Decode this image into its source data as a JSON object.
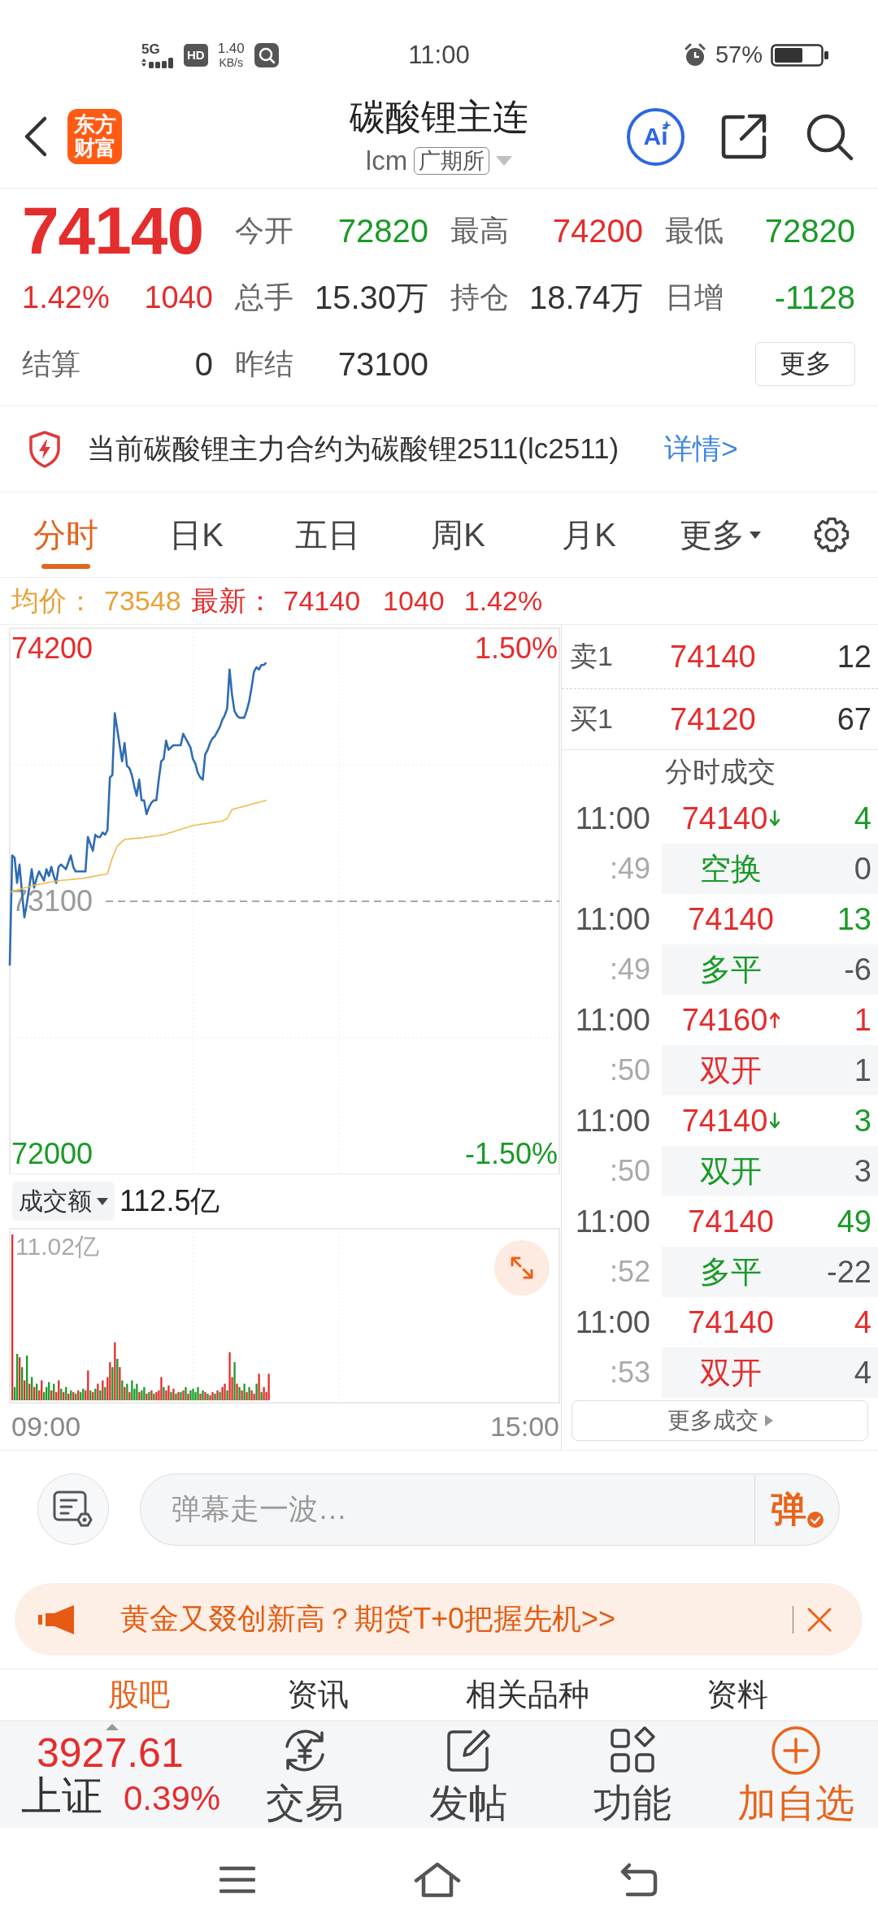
{
  "status_bar": {
    "network": "5G",
    "hd_badge": "HD",
    "speed_value": "1.40",
    "speed_unit": "KB/s",
    "time": "11:00",
    "battery": "57%"
  },
  "header": {
    "logo_text": "东方财富",
    "title": "碳酸锂主连",
    "code": "lcm",
    "exchange": "广期所",
    "ai_label": "Ai"
  },
  "quote": {
    "price": "74140",
    "change_percent": "1.42%",
    "change": "1040",
    "rising": true,
    "stats": [
      {
        "label": "今开",
        "value": "72820",
        "color": "#1a9a28"
      },
      {
        "label": "最高",
        "value": "74200",
        "color": "#e42d2d"
      },
      {
        "label": "最低",
        "value": "72820",
        "color": "#1a9a28"
      },
      {
        "label": "总手",
        "value": "15.30万",
        "color": "#333333"
      },
      {
        "label": "持仓",
        "value": "18.74万",
        "color": "#333333"
      },
      {
        "label": "日增",
        "value": "-1128",
        "color": "#1a9a28"
      },
      {
        "label": "结算",
        "value": "0",
        "color": "#333333"
      },
      {
        "label": "昨结",
        "value": "73100",
        "color": "#333333"
      }
    ],
    "more_button": "更多"
  },
  "notice": {
    "text": "当前碳酸锂主力合约为碳酸锂2511(lc2511)",
    "link": "详情>"
  },
  "chart_tabs": [
    {
      "label": "分时",
      "selected": true,
      "dropdown": false
    },
    {
      "label": "日K",
      "selected": false,
      "dropdown": false
    },
    {
      "label": "五日",
      "selected": false,
      "dropdown": false
    },
    {
      "label": "周K",
      "selected": false,
      "dropdown": false
    },
    {
      "label": "月K",
      "selected": false,
      "dropdown": false
    },
    {
      "label": "更多",
      "selected": false,
      "dropdown": true
    }
  ],
  "info_line": {
    "average_label": "均价：",
    "average_value": "73548",
    "latest_label": "最新：",
    "latest_price": "74140",
    "latest_change": "1040",
    "latest_percent": "1.42%"
  },
  "price_chart": {
    "chart_data": {
      "type": "line",
      "categories": [
        null,
        null,
        null,
        null,
        null,
        null,
        null,
        null,
        null,
        null,
        null,
        null,
        null,
        null,
        null,
        null,
        null,
        null,
        null,
        null,
        null,
        null,
        null,
        null,
        null,
        null,
        null,
        null,
        null,
        null,
        null,
        null,
        null,
        null,
        null,
        null,
        null,
        null,
        null,
        null,
        null,
        null,
        null,
        null,
        null,
        null,
        null,
        null,
        null,
        null,
        null,
        null,
        null,
        null,
        null,
        null,
        null,
        null,
        null,
        null,
        null,
        null,
        null,
        null,
        null,
        null,
        null,
        null,
        null,
        null,
        null,
        null,
        null,
        null,
        null,
        null,
        null,
        null,
        null,
        null,
        null,
        null,
        null,
        null,
        null,
        null,
        null,
        null,
        null,
        null,
        null,
        null,
        null,
        null,
        null,
        null,
        null,
        null,
        null,
        null,
        null,
        null,
        null,
        null,
        null,
        null,
        null,
        null,
        null,
        null,
        null,
        null,
        null,
        null,
        null,
        null,
        null,
        null,
        null,
        null,
        null,
        null,
        null,
        null,
        null,
        null,
        null,
        null,
        null,
        null,
        null,
        null,
        null,
        null,
        null,
        null,
        null,
        null,
        null,
        null,
        null,
        null,
        null,
        null,
        null,
        null,
        null,
        null,
        null,
        null,
        null,
        null,
        null,
        null,
        null,
        null,
        null,
        null,
        null,
        null,
        null,
        null,
        null,
        null,
        null,
        null,
        null,
        null,
        null,
        null,
        null,
        null,
        null,
        null,
        null,
        null,
        null,
        null,
        null,
        null,
        null,
        null,
        null,
        null,
        null,
        null,
        null,
        null,
        null,
        null,
        null,
        null,
        null,
        null,
        null,
        null,
        null,
        null,
        null,
        null,
        null,
        null,
        null,
        null,
        null,
        null,
        null,
        null,
        null,
        null,
        null,
        null,
        null,
        null,
        null,
        null,
        null,
        null,
        null,
        null,
        null,
        null,
        null,
        null,
        null,
        null
      ],
      "series": [
        {
          "color": "#2f6cb3",
          "values": [
            72820,
            73300,
            73290,
            73180,
            73260,
            73140,
            73030,
            73090,
            73160,
            73240,
            73160,
            73200,
            73230,
            73210,
            73190,
            73240,
            73210,
            73250,
            73210,
            73180,
            73250,
            73260,
            73250,
            73240,
            73270,
            73300,
            73250,
            73230,
            73230,
            73230,
            73230,
            73230,
            73380,
            73350,
            73320,
            73390,
            73380,
            73380,
            73400,
            73390,
            73410,
            73640,
            73650,
            73920,
            73850,
            73780,
            73710,
            73790,
            73690,
            73680,
            73650,
            73600,
            73560,
            73630,
            73540,
            73540,
            73480,
            73510,
            73530,
            73540,
            73540,
            73630,
            73710,
            73720,
            73800,
            73760,
            73770,
            73780,
            73780,
            73780,
            73780,
            73830,
            73810,
            73790,
            73770,
            73720,
            73700,
            73660,
            73640,
            73630,
            73740,
            73760,
            73790,
            73810,
            73820,
            73840,
            73860,
            73890,
            73910,
            73940,
            74110,
            74000,
            73930,
            73910,
            73900,
            73900,
            73900,
            73930,
            73970,
            74030,
            74100,
            74120,
            74110,
            74130,
            74130,
            74140,
            null,
            null,
            null,
            null,
            null,
            null,
            null,
            null,
            null,
            null,
            null,
            null,
            null,
            null,
            null,
            null,
            null,
            null,
            null,
            null,
            null,
            null,
            null,
            null,
            null,
            null,
            null,
            null,
            null,
            null,
            null,
            null,
            null,
            null,
            null,
            null,
            null,
            null,
            null,
            null,
            null,
            null,
            null,
            null,
            null,
            null,
            null,
            null,
            null,
            null,
            null,
            null,
            null,
            null,
            null,
            null,
            null,
            null,
            null,
            null,
            null,
            null,
            null,
            null,
            null,
            null,
            null,
            null,
            null,
            null,
            null,
            null,
            null,
            null,
            null,
            null,
            null,
            null,
            null,
            null,
            null,
            null,
            null,
            null,
            null,
            null,
            null,
            null,
            null,
            null,
            null,
            null,
            null,
            null,
            null,
            null,
            null,
            null,
            null,
            null,
            null,
            null,
            null,
            null,
            null,
            null,
            null,
            null,
            null,
            null,
            null,
            null,
            null,
            null,
            null,
            null,
            null,
            null,
            null,
            null
          ]
        },
        {
          "color": "#f2b94a",
          "values": [
            73140,
            73143,
            73146,
            73149,
            73152,
            73155,
            73158,
            73161,
            73164,
            73167,
            73170,
            73172,
            73174,
            73176,
            73178,
            73180,
            73182,
            73184,
            73186,
            73188,
            73190,
            73191,
            73192,
            73193,
            73194,
            73195,
            73196,
            73197,
            73198,
            73199,
            73200,
            73202,
            73204,
            73206,
            73208,
            73210,
            73212,
            73214,
            73216,
            73218,
            73220,
            73255,
            73290,
            73315,
            73340,
            73350,
            73360,
            73370,
            73371,
            73372,
            73373,
            73374,
            73375,
            73376,
            73377,
            73378,
            73380,
            73381,
            73383,
            73384,
            73386,
            73387,
            73389,
            73390,
            73393,
            73397,
            73400,
            73403,
            73407,
            73410,
            73413,
            73417,
            73420,
            73423,
            73427,
            73430,
            73432,
            73433,
            73435,
            73437,
            73438,
            73440,
            73442,
            73443,
            73445,
            73447,
            73448,
            73450,
            73455,
            73460,
            73480,
            73500,
            73503,
            73506,
            73509,
            73511,
            73514,
            73517,
            73520,
            73523,
            73526,
            73529,
            73531,
            73534,
            73537,
            73540,
            null,
            null,
            null,
            null,
            null,
            null,
            null,
            null,
            null,
            null,
            null,
            null,
            null,
            null,
            null,
            null,
            null,
            null,
            null,
            null,
            null,
            null,
            null,
            null,
            null,
            null,
            null,
            null,
            null,
            null,
            null,
            null,
            null,
            null,
            null,
            null,
            null,
            null,
            null,
            null,
            null,
            null,
            null,
            null,
            null,
            null,
            null,
            null,
            null,
            null,
            null,
            null,
            null,
            null,
            null,
            null,
            null,
            null,
            null,
            null,
            null,
            null,
            null,
            null,
            null,
            null,
            null,
            null,
            null,
            null,
            null,
            null,
            null,
            null,
            null,
            null,
            null,
            null,
            null,
            null,
            null,
            null,
            null,
            null,
            null,
            null,
            null,
            null,
            null,
            null,
            null,
            null,
            null,
            null,
            null,
            null,
            null,
            null,
            null,
            null,
            null,
            null,
            null,
            null,
            null,
            null,
            null,
            null,
            null,
            null,
            null,
            null,
            null,
            null,
            null,
            null,
            null,
            null,
            null,
            null
          ]
        }
      ],
      "ylim": [
        71910,
        74290
      ],
      "yticks": [
        72000,
        73100,
        74200
      ],
      "ref_lines": [
        {
          "axis": "y",
          "value": 73100
        }
      ]
    },
    "time_labels": [
      "09:00",
      "15:00"
    ],
    "percent_ticks": [
      {
        "label": "1.50%",
        "color": "#e42d2d"
      },
      {
        "label": "-1.50%",
        "color": "#1a9a28"
      }
    ]
  },
  "volume": {
    "selector": "成交额",
    "total": "112.5亿",
    "max_label": "11.02亿"
  },
  "order_book": [
    {
      "label": "卖1",
      "price": "74140",
      "volume": "12"
    },
    {
      "label": "买1",
      "price": "74120",
      "volume": "67"
    }
  ],
  "trades_title": "分时成交",
  "trades": [
    {
      "time": "11:00",
      "price": "74140",
      "kind": "downtick",
      "volume": "4",
      "seconds": ":49",
      "type": "空换",
      "change": "0",
      "color": "#1a9a28"
    },
    {
      "time": "11:00",
      "price": "74140",
      "kind": "plain",
      "volume": "13",
      "seconds": ":49",
      "type": "多平",
      "change": "-6",
      "color": "#1a9a28"
    },
    {
      "time": "11:00",
      "price": "74160",
      "kind": "uptick",
      "volume": "1",
      "seconds": ":50",
      "type": "双开",
      "change": "1",
      "color": "#e42d2d"
    },
    {
      "time": "11:00",
      "price": "74140",
      "kind": "downtick",
      "volume": "3",
      "seconds": ":50",
      "type": "双开",
      "change": "3",
      "color": "#1a9a28"
    },
    {
      "time": "11:00",
      "price": "74140",
      "kind": "plain",
      "volume": "49",
      "seconds": ":52",
      "type": "多平",
      "change": "-22",
      "color": "#1a9a28"
    },
    {
      "time": "11:00",
      "price": "74140",
      "kind": "plain",
      "volume": "4",
      "seconds": ":53",
      "type": "双开",
      "change": "4",
      "color": "#e42d2d"
    }
  ],
  "more_trades_button": "更多成交",
  "danmaku": {
    "placeholder": "弹幕走一波…",
    "send_label": "弹"
  },
  "banner": {
    "text": "黄金又叕创新高？期货T+0把握先机>>"
  },
  "section_tabs": [
    {
      "label": "股吧",
      "selected": true
    },
    {
      "label": "资讯",
      "selected": false
    },
    {
      "label": "相关品种",
      "selected": false
    },
    {
      "label": "资料",
      "selected": false
    }
  ],
  "bottom_bar": {
    "index_value": "3927.61",
    "index_name": "上证",
    "index_change": "0.39%",
    "rising": true,
    "actions": [
      {
        "label": "交易",
        "kind": "trade",
        "highlighted": false
      },
      {
        "label": "发帖",
        "kind": "post",
        "highlighted": false
      },
      {
        "label": "功能",
        "kind": "tools",
        "highlighted": false
      },
      {
        "label": "加自选",
        "kind": "watchlist",
        "highlighted": true
      }
    ]
  }
}
